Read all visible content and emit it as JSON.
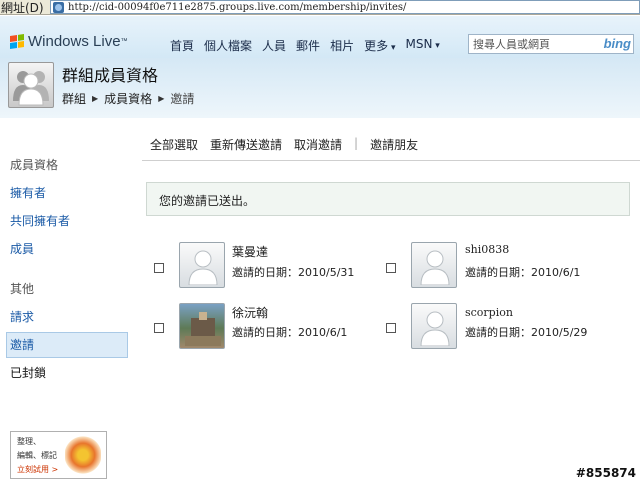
{
  "addressbar": {
    "label": "網址(D)",
    "url": "http://cid-00094f0e711e2875.groups.live.com/membership/invites/"
  },
  "header": {
    "logo": "Windows Live",
    "logo_tm": "™",
    "nav": [
      "首頁",
      "個人檔案",
      "人員",
      "郵件",
      "相片",
      "更多",
      "MSN"
    ],
    "search_placeholder": "搜尋人員或網頁",
    "bing": "bing"
  },
  "group": {
    "title": "群組成員資格",
    "breadcrumb": [
      "群組",
      "成員資格",
      "邀請"
    ]
  },
  "sidebar": {
    "heading1": "成員資格",
    "items1": [
      "擁有者",
      "共同擁有者",
      "成員"
    ],
    "heading2": "其他",
    "items2": [
      "請求",
      "邀請",
      "已封鎖"
    ],
    "ad": {
      "line1": "整理、",
      "line2": "編輯、標記",
      "link": "立刻試用 >"
    }
  },
  "toolbar": {
    "select_all": "全部選取",
    "resend": "重新傳送邀請",
    "cancel": "取消邀請",
    "invite": "邀請朋友"
  },
  "notice": "您的邀請已送出。",
  "invites": [
    {
      "name": "葉曼達",
      "date": "邀請的日期：2010/5/31"
    },
    {
      "name": "shi0838",
      "date": "邀請的日期：2010/6/1"
    },
    {
      "name": "徐沅翰",
      "date": "邀請的日期：2010/6/1"
    },
    {
      "name": "scorpion",
      "date": "邀請的日期：2010/5/29"
    }
  ],
  "watermark": "#855874"
}
